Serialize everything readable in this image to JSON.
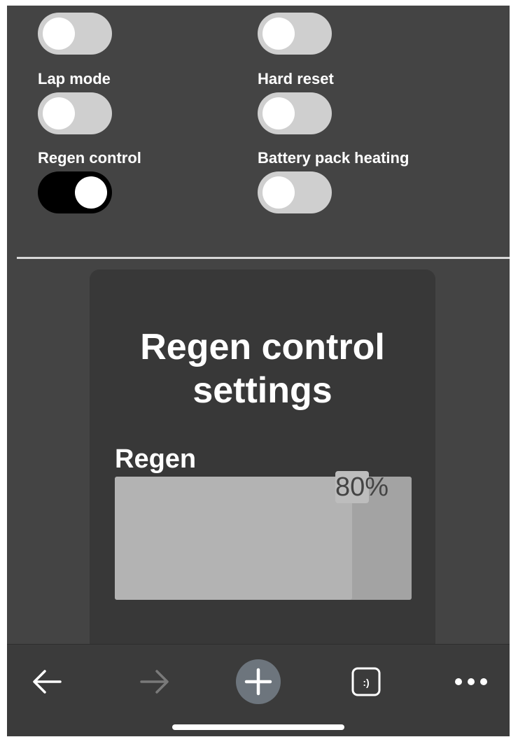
{
  "toggles": [
    {
      "label": "",
      "on": false
    },
    {
      "label": "",
      "on": false
    },
    {
      "label": "Lap mode",
      "on": false
    },
    {
      "label": "Hard reset",
      "on": false
    },
    {
      "label": "Regen control",
      "on": true
    },
    {
      "label": "Battery pack heating",
      "on": false
    }
  ],
  "card": {
    "title_line1": "Regen control",
    "title_line2": "settings",
    "slider_label": "Regen",
    "slider_value_text": "80%",
    "slider_value": 0.8
  },
  "bottom_bar": {
    "icons": [
      "back-arrow-icon",
      "forward-arrow-icon",
      "plus-icon",
      "smiley-tab-icon",
      "more-icon"
    ]
  },
  "colors": {
    "background": "#444444",
    "card": "#383838",
    "toggle_off": "#cfcfcf",
    "toggle_on": "#000000",
    "slider_fill": "#b3b3b3",
    "slider_track": "#a3a3a3"
  }
}
